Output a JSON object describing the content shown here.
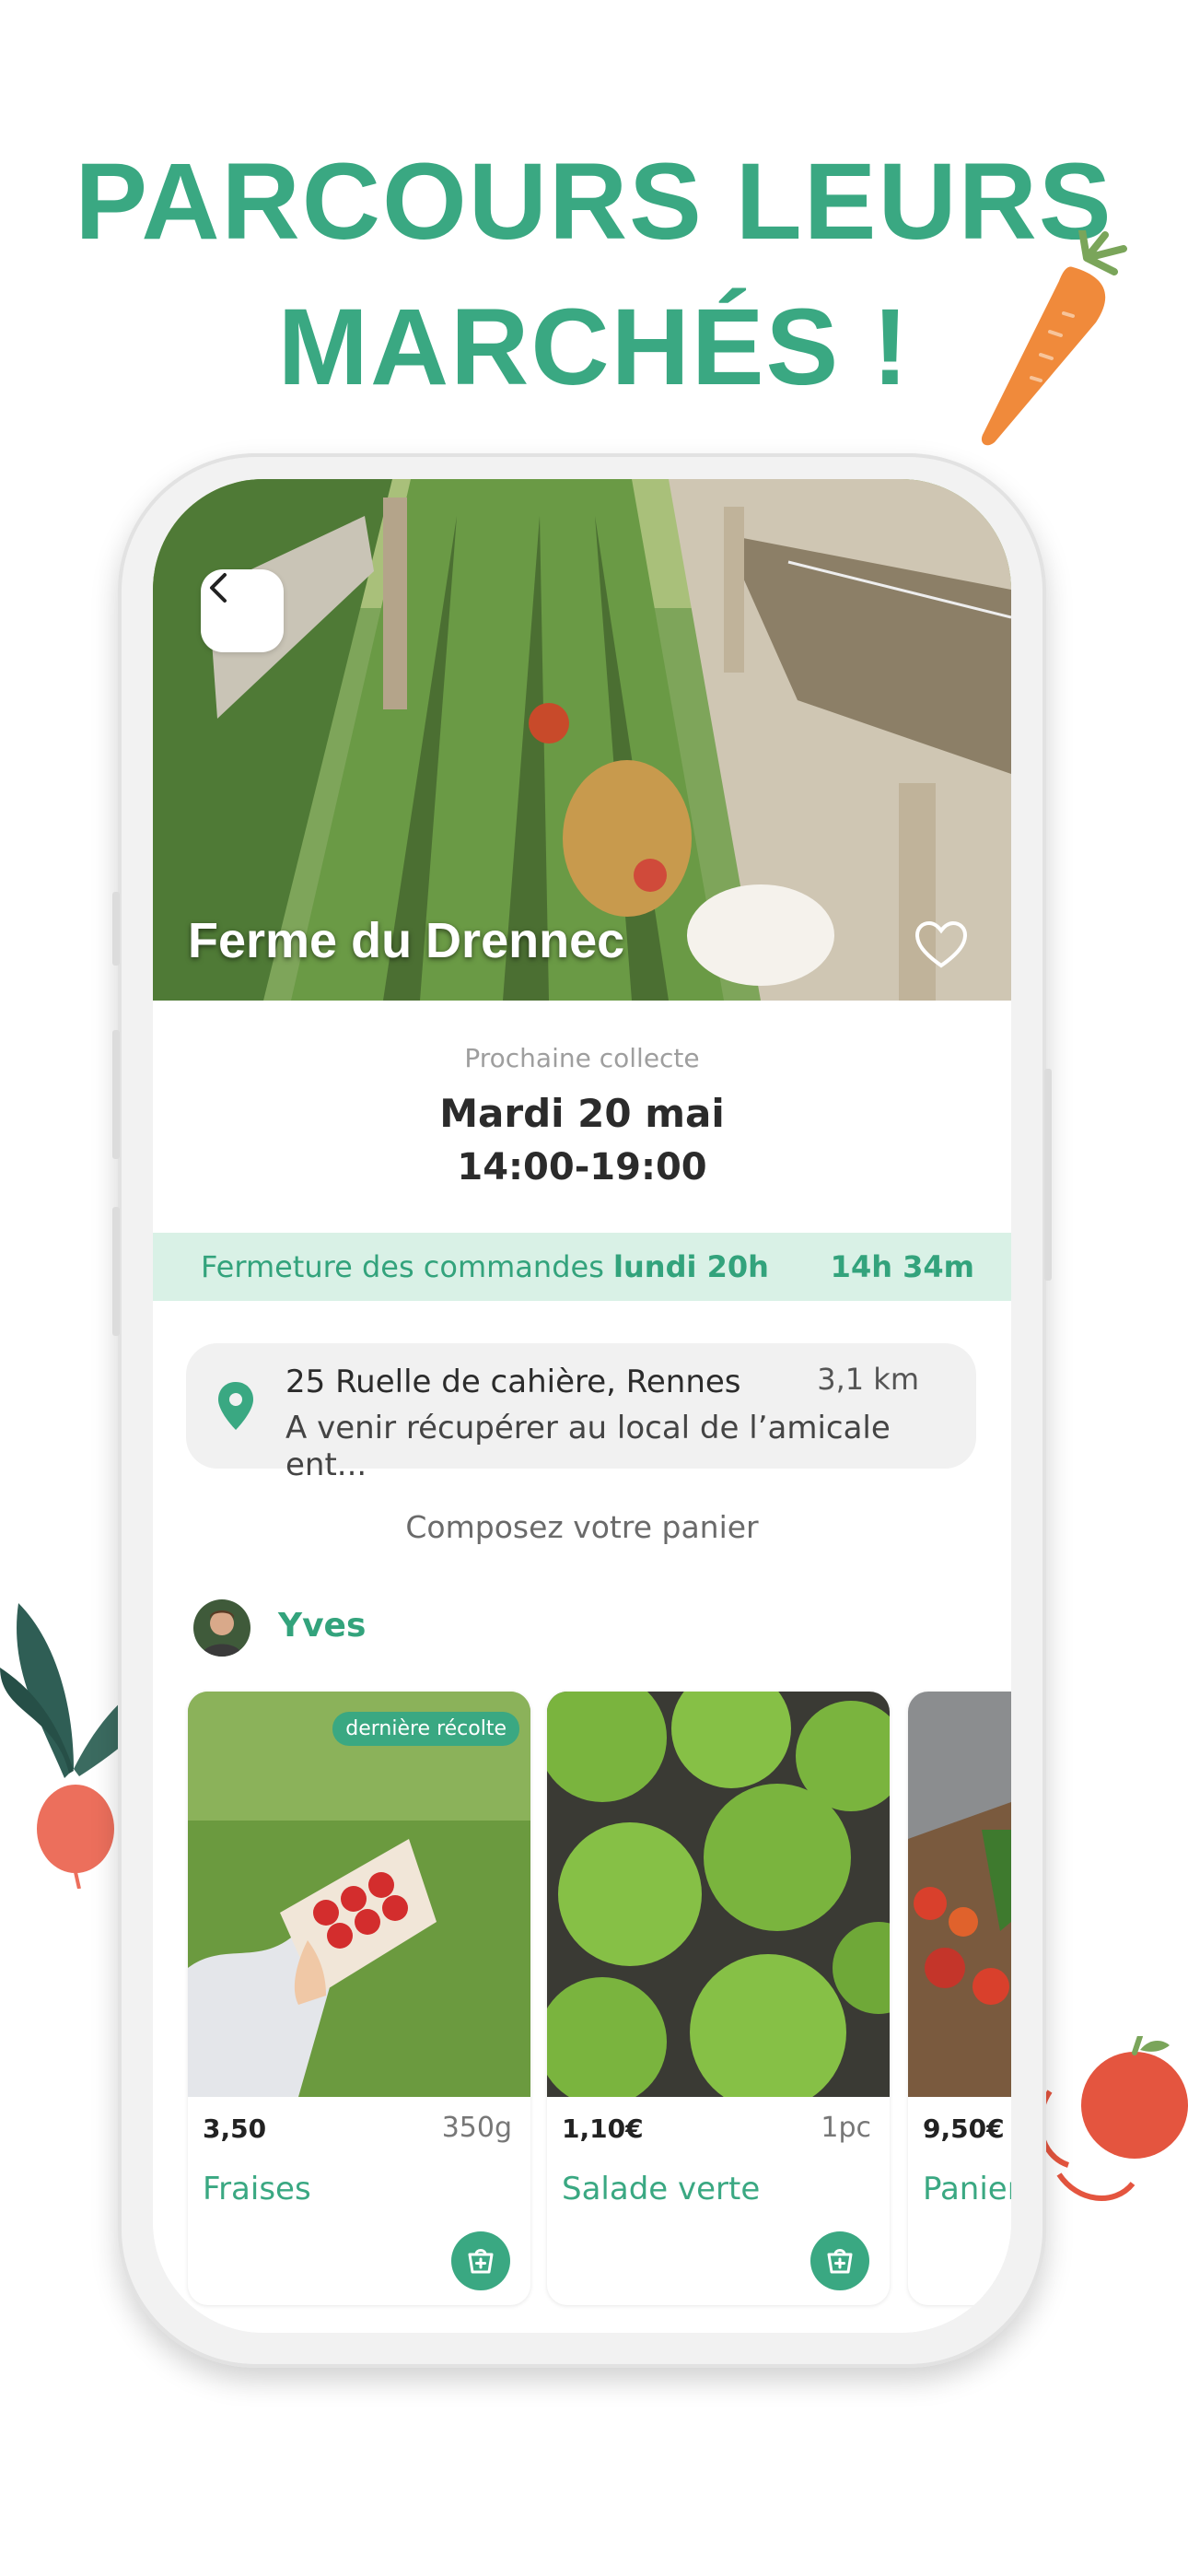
{
  "headline": {
    "line1": "PARCOURS LEURS",
    "line2": "MARCHÉS !"
  },
  "colors": {
    "accent": "#3aa882",
    "banner_bg": "#d9f1e6"
  },
  "farm": {
    "name": "Ferme du Drennec"
  },
  "collect": {
    "label": "Prochaine collecte",
    "date": "Mardi 20 mai",
    "hours": "14:00-19:00"
  },
  "banner": {
    "text": "Fermeture des commandes",
    "deadline": "lundi 20h",
    "countdown": "14h 34m"
  },
  "address": {
    "street": "25 Ruelle de cahière, Rennes",
    "distance": "3,1 km",
    "note": "A venir récupérer au local de l’amicale ent..."
  },
  "compose_label": "Composez votre panier",
  "producer": {
    "name": "Yves"
  },
  "products": [
    {
      "price": "3,50",
      "qty": "350g",
      "name": "Fraises",
      "tag": "dernière récolte"
    },
    {
      "price": "1,10€",
      "qty": "1pc",
      "name": "Salade verte"
    },
    {
      "price": "9,50€",
      "name": "Panier"
    }
  ],
  "icons": {
    "back": "chevron-left-icon",
    "favorite": "heart-icon",
    "location": "pin-icon",
    "add_to_cart": "cart-plus-icon"
  }
}
